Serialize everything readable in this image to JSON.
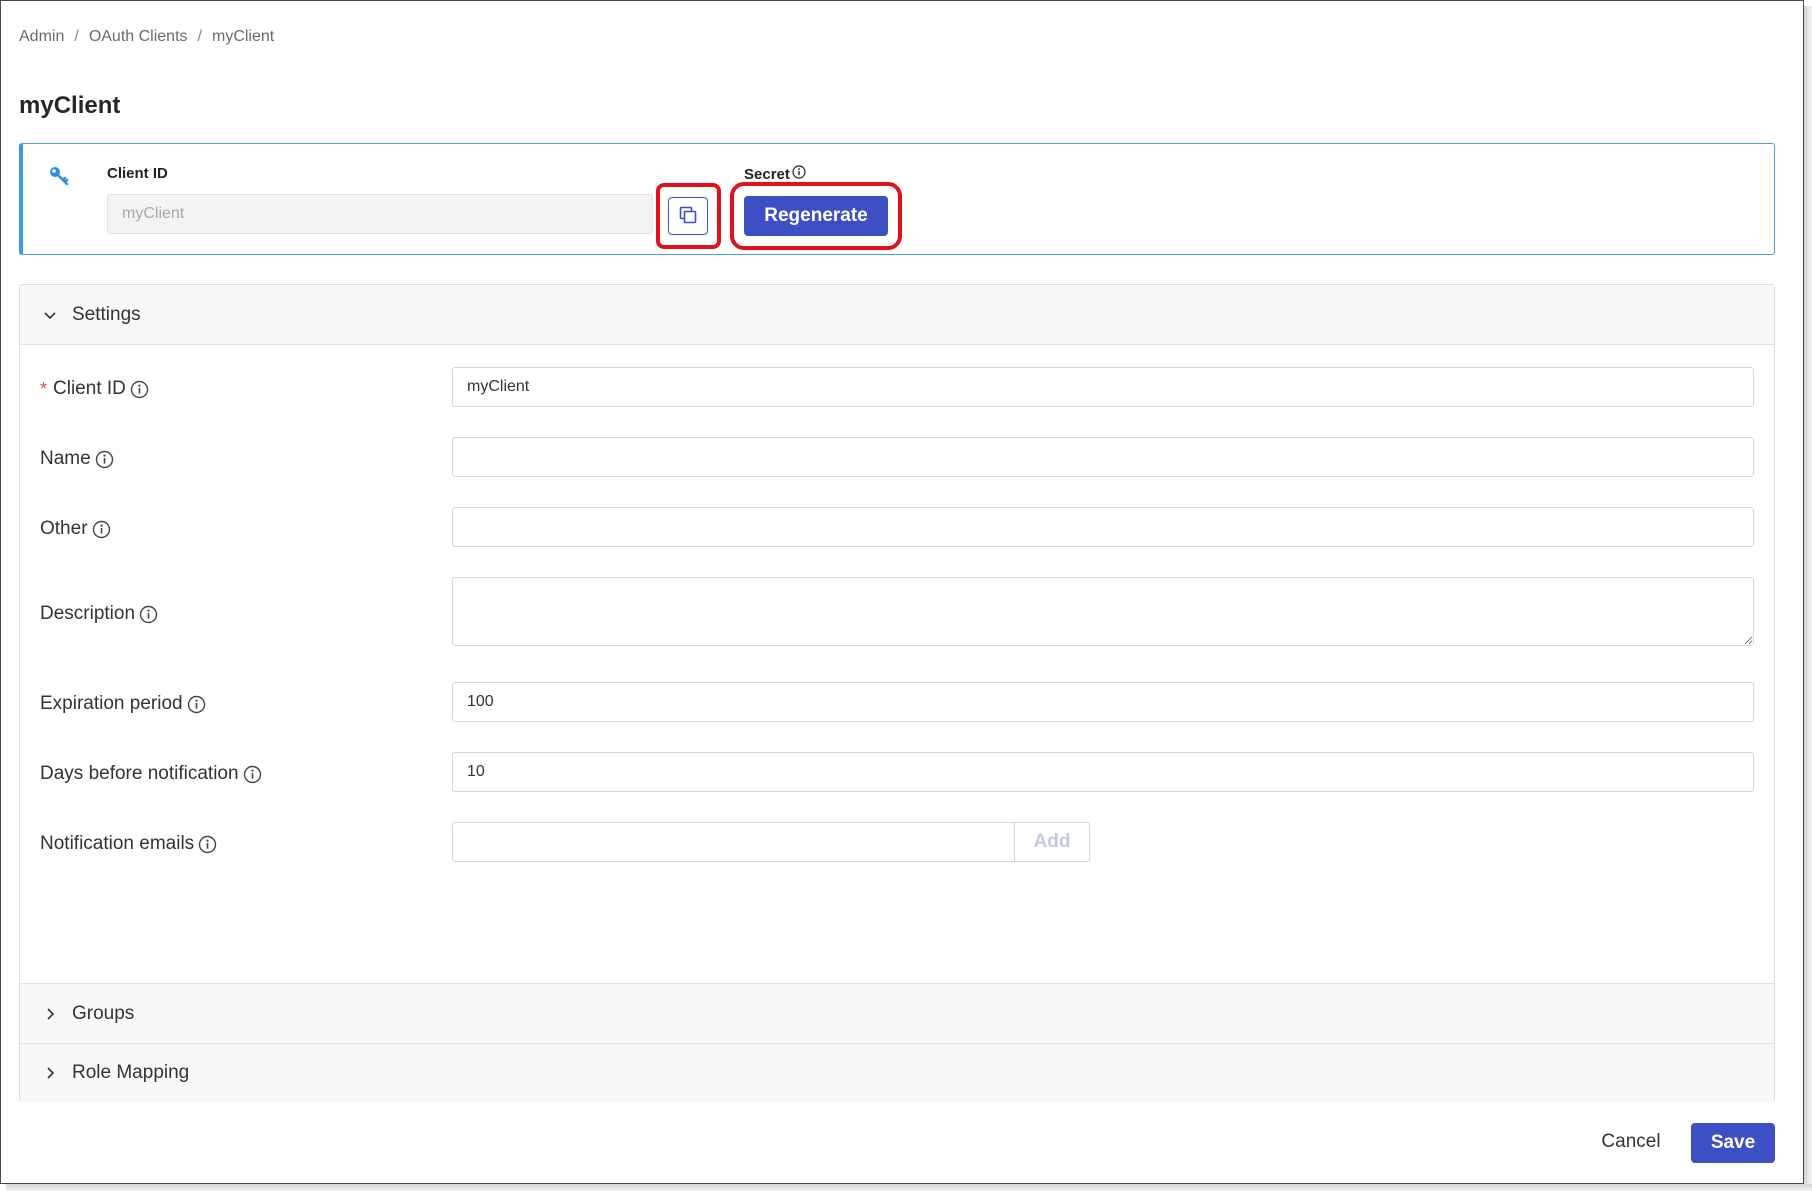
{
  "breadcrumb": {
    "items": [
      "Admin",
      "OAuth Clients",
      "myClient"
    ],
    "separator": "/"
  },
  "page": {
    "title": "myClient"
  },
  "credentials": {
    "client_id_label": "Client ID",
    "client_id_value": "myClient",
    "secret_label": "Secret",
    "regenerate_label": "Regenerate",
    "key_icon": "key-icon",
    "copy_icon": "copy-icon"
  },
  "settings": {
    "header": "Settings",
    "fields": {
      "client_id": {
        "label": "Client ID",
        "value": "myClient",
        "required": true
      },
      "name": {
        "label": "Name",
        "value": ""
      },
      "other": {
        "label": "Other",
        "value": ""
      },
      "description": {
        "label": "Description",
        "value": ""
      },
      "expiration_period": {
        "label": "Expiration period",
        "value": "100"
      },
      "days_before_notification": {
        "label": "Days before notification",
        "value": "10"
      },
      "notification_emails": {
        "label": "Notification emails",
        "value": "",
        "add_label": "Add"
      }
    }
  },
  "sections": {
    "groups": "Groups",
    "role_mapping": "Role Mapping"
  },
  "footer": {
    "cancel_label": "Cancel",
    "save_label": "Save"
  },
  "colors": {
    "primary": "#3d4fc4",
    "highlight": "#e0101d",
    "accent_border": "#3b9ae1",
    "required": "#e5484d"
  }
}
